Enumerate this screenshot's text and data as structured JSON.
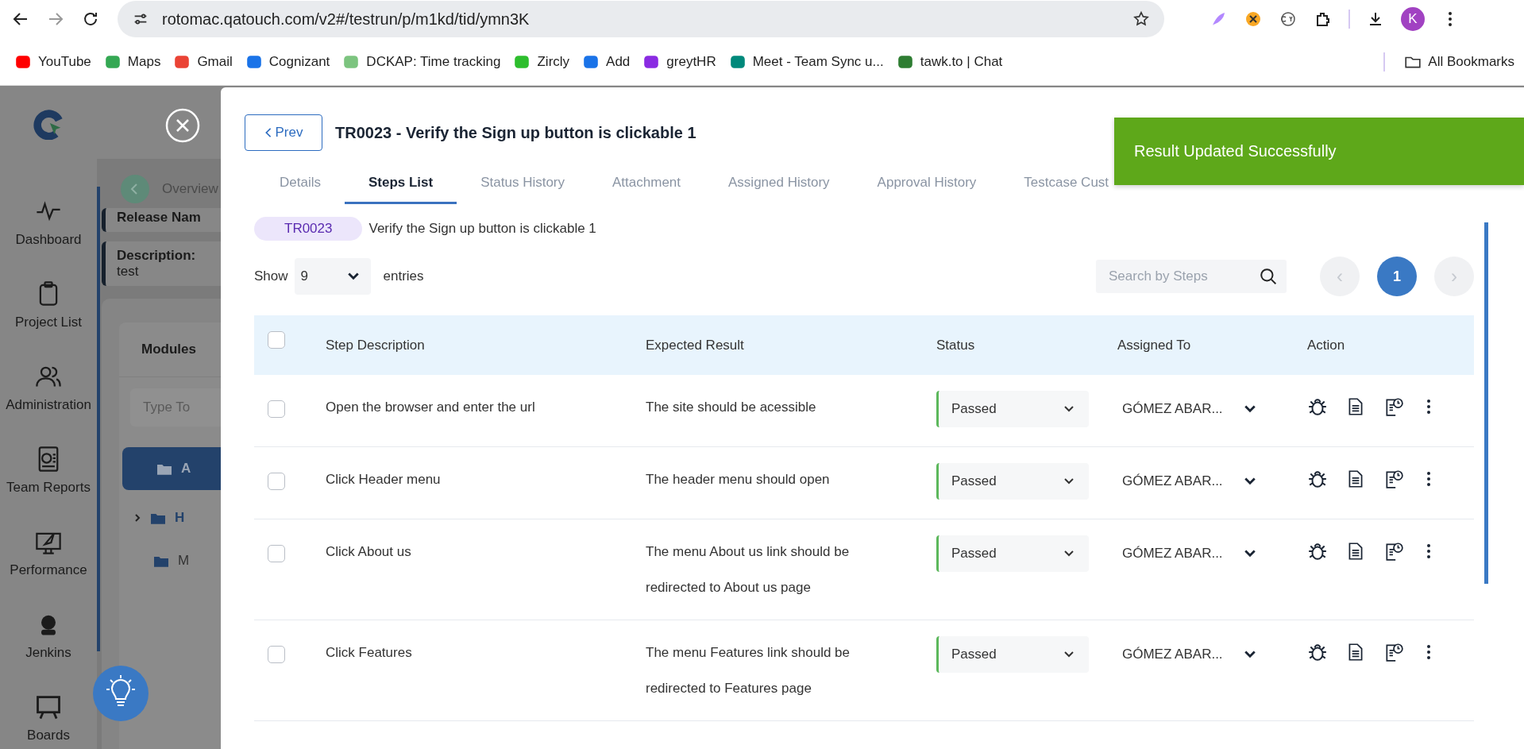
{
  "browser": {
    "url": "rotomac.qatouch.com/v2#/testrun/p/m1kd/tid/ymn3K",
    "profile_initial": "K",
    "bookmarks": [
      "YouTube",
      "Maps",
      "Gmail",
      "Cognizant",
      "DCKAP: Time tracking",
      "Zircly",
      "Add",
      "greytHR",
      "Meet - Team Sync u...",
      "tawk.to | Chat"
    ],
    "all_bookmarks": "All Bookmarks"
  },
  "sidebar": {
    "items": [
      "Dashboard",
      "Project List",
      "Administration",
      "Team Reports",
      "Performance",
      "Jenkins",
      "Boards"
    ]
  },
  "background": {
    "breadcrumb": "Overview",
    "release_label": "Release Nam",
    "description_label": "Description:",
    "description": "test",
    "modules_title": "Modules",
    "filter_placeholder": "Type To",
    "tree": [
      {
        "label": "A",
        "selected": true
      },
      {
        "label": "H",
        "selected": false
      },
      {
        "label": "M",
        "selected": false
      }
    ]
  },
  "modal": {
    "prev": "Prev",
    "title": "TR0023 - Verify the Sign up button is clickable 1",
    "tabs": [
      {
        "label": "Details",
        "selected": false
      },
      {
        "label": "Steps List",
        "selected": true
      },
      {
        "label": "Status History",
        "selected": false
      },
      {
        "label": "Attachment",
        "selected": false
      },
      {
        "label": "Assigned History",
        "selected": false
      },
      {
        "label": "Approval History",
        "selected": false
      },
      {
        "label": "Testcase Cust",
        "selected": false
      }
    ],
    "toast": "Result Updated Successfully",
    "case_id": "TR0023",
    "case_title": "Verify the Sign up button is clickable 1",
    "show_label": "Show",
    "entries_value": "9",
    "entries_label": "entries",
    "search": {
      "placeholder": "Search by Steps"
    },
    "pager": {
      "prev": "‹",
      "next": "›",
      "pages": [
        {
          "label": "1",
          "selected": true
        }
      ]
    },
    "table": {
      "select_all": {
        "checked": false
      },
      "columns": [
        "Step Description",
        "Expected Result",
        "Status",
        "Assigned To",
        "Action"
      ],
      "rows": [
        {
          "checked": false,
          "step": "Open the browser and enter the url",
          "expected": "The site should be acessible",
          "status": "Passed",
          "assignee": "GÓMEZ ABAR..."
        },
        {
          "checked": false,
          "step": "Click Header menu",
          "expected": "The header menu should open",
          "status": "Passed",
          "assignee": "GÓMEZ ABAR..."
        },
        {
          "checked": false,
          "step": "Click About us",
          "expected": "The menu About us link should be redirected to About us page",
          "status": "Passed",
          "assignee": "GÓMEZ ABAR..."
        },
        {
          "checked": false,
          "step": "Click Features",
          "expected": "The menu Features link should be redirected to Features page",
          "status": "Passed",
          "assignee": "GÓMEZ ABAR..."
        }
      ]
    }
  }
}
